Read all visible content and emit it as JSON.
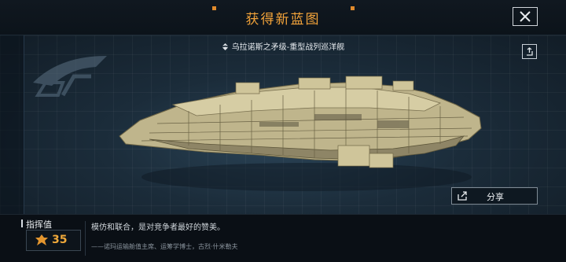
{
  "header": {
    "title": "获得新蓝图"
  },
  "ship": {
    "name": "乌拉诺斯之矛级-重型战列巡洋舰"
  },
  "actions": {
    "share_label": "分享"
  },
  "footer": {
    "command_label": "指挥值",
    "command_value": "35",
    "quote": "模仿和联合，是对竞争者最好的赞美。",
    "attribution": "——诺玛运输舱值主席、运筹学博士，古烈·什米勒夫"
  },
  "colors": {
    "accent": "#f2a33a",
    "background": "#0b1118"
  },
  "icons": [
    "close-icon",
    "rank-icon",
    "share-square-icon",
    "share-icon",
    "command-icon",
    "faction-logo"
  ]
}
